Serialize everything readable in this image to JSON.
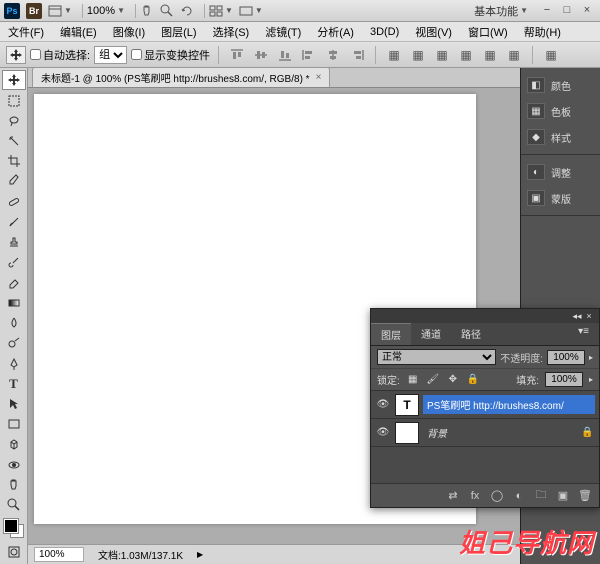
{
  "title_bar": {
    "zoom": "100%",
    "workspace_label": "基本功能"
  },
  "menus": {
    "file": "文件(F)",
    "edit": "编辑(E)",
    "image": "图像(I)",
    "layer": "图层(L)",
    "select": "选择(S)",
    "filter": "滤镜(T)",
    "analysis": "分析(A)",
    "threeD": "3D(D)",
    "view": "视图(V)",
    "window": "窗口(W)",
    "help": "帮助(H)"
  },
  "options": {
    "auto_select_label": "自动选择:",
    "group_label": "组",
    "show_transform_label": "显示变换控件"
  },
  "document": {
    "tab_title": "未标题-1 @ 100% (PS笔刷吧 http://brushes8.com/, RGB/8) *"
  },
  "status": {
    "zoom": "100%",
    "doc_info": "文档:1.03M/137.1K"
  },
  "right_panels": {
    "color": "颜色",
    "swatches": "色板",
    "styles": "样式",
    "adjustments": "调整",
    "masks": "蒙版"
  },
  "layers_panel": {
    "tab_layers": "图层",
    "tab_channels": "通道",
    "tab_paths": "路径",
    "blend_mode": "正常",
    "opacity_label": "不透明度:",
    "opacity_value": "100%",
    "lock_label": "锁定:",
    "fill_label": "填充:",
    "fill_value": "100%",
    "layer_text_name": "PS笔刷吧 http://brushes8.com/",
    "layer_bg_name": "背景"
  },
  "watermark": "姐己导航网"
}
